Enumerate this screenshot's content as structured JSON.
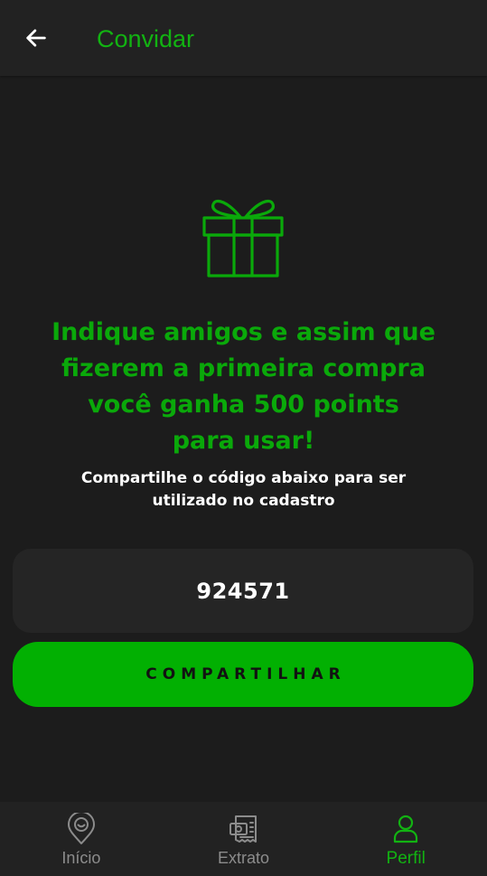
{
  "header": {
    "title": "Convidar",
    "back_icon": "arrow-left-icon"
  },
  "hero": {
    "icon": "gift-icon",
    "headline_lines": [
      "Indique amigos e assim que",
      "fizerem a primeira compra",
      "você ganha 500 points",
      "para usar!"
    ],
    "subtitle_lines": [
      "Compartilhe o código abaixo para ser",
      "utilizado no cadastro"
    ]
  },
  "referral": {
    "code": "924571",
    "share_label": "COMPARTILHAR"
  },
  "bottom_nav": {
    "items": [
      {
        "label": "Início",
        "icon": "map-pin-icon",
        "active": false
      },
      {
        "label": "Extrato",
        "icon": "receipt-icon",
        "active": false
      },
      {
        "label": "Perfil",
        "icon": "user-icon",
        "active": true
      }
    ]
  },
  "colors": {
    "accent": "#0aa90a",
    "button": "#02b002",
    "background": "#1c1c1c",
    "surface": "#222222",
    "inactive": "#8c8c8c"
  }
}
